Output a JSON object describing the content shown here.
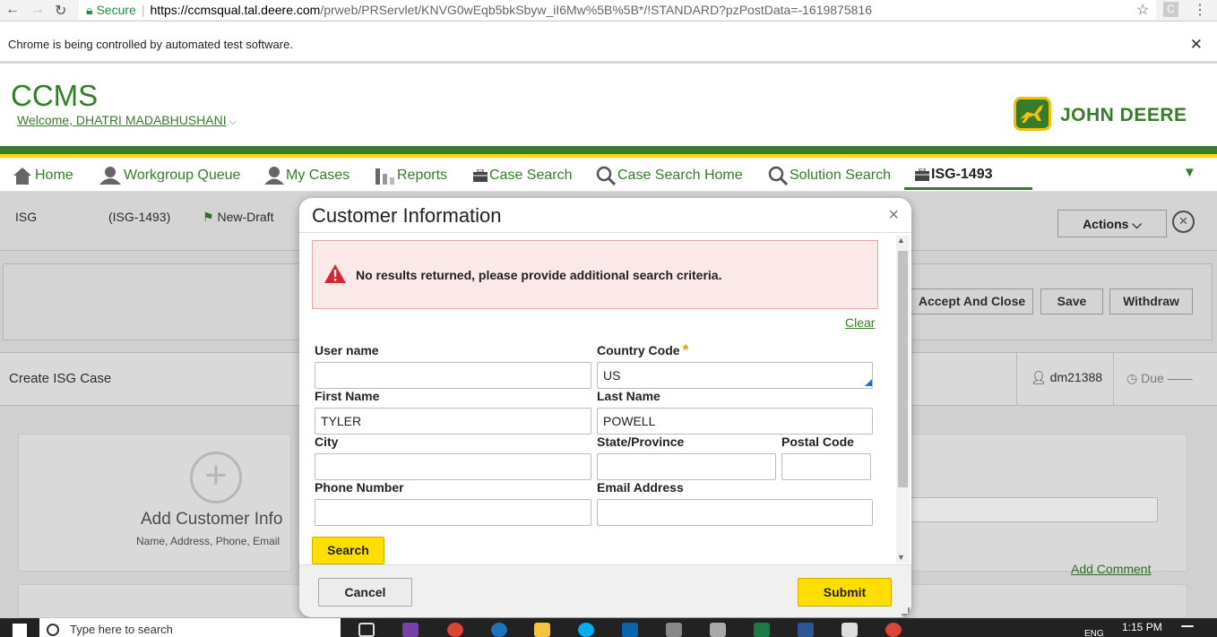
{
  "browser": {
    "secure_label": "Secure",
    "url_domain": "https://ccmsqual.tal.deere.com",
    "url_path": "/prweb/PRServlet/KNVG0wEqb5bkSbyw_iI6Mw%5B%5B*/!STANDARD?pzPostData=-1619875816",
    "profile_label": "C",
    "infobar_text": "Chrome is being controlled by automated test software.",
    "infobar_close": "✕"
  },
  "header": {
    "app_title": "CCMS",
    "welcome_prefix": "Welcome, ",
    "user_name": "DHATRI MADABHUSHANI",
    "logo_text": "JOHN DEERE"
  },
  "nav": {
    "items": [
      {
        "label": "Home",
        "icon": "home-icon"
      },
      {
        "label": "Workgroup Queue",
        "icon": "users-icon"
      },
      {
        "label": "My Cases",
        "icon": "user-icon"
      },
      {
        "label": "Reports",
        "icon": "bar-chart-icon"
      },
      {
        "label": "Case Search",
        "icon": "briefcase-icon"
      },
      {
        "label": "Case Search Home",
        "icon": "search-icon"
      },
      {
        "label": "Solution Search",
        "icon": "search-icon"
      },
      {
        "label": "ISG-1493",
        "icon": "briefcase-icon"
      }
    ],
    "more": "▼"
  },
  "case": {
    "type": "ISG",
    "id": "(ISG-1493)",
    "status": "New-Draft",
    "actions_label": "Actions",
    "buttons": [
      "Accept And Close",
      "Save",
      "Withdraw"
    ],
    "create_title": "Create ISG Case",
    "owner": "dm21388",
    "due_label": "Due",
    "due_value": "——",
    "add_customer_title": "Add Customer Info",
    "add_customer_sub": "Name, Address, Phone, Email",
    "add_comment": "Add Comment"
  },
  "modal": {
    "title": "Customer Information",
    "close": "×",
    "error_message": "No results returned, please provide additional search criteria.",
    "clear_label": "Clear",
    "required_mark": "*",
    "fields": {
      "username": {
        "label": "User name",
        "value": ""
      },
      "country_code": {
        "label": "Country Code",
        "value": "US"
      },
      "first_name": {
        "label": "First Name",
        "value": "TYLER"
      },
      "last_name": {
        "label": "Last Name",
        "value": "POWELL"
      },
      "city": {
        "label": "City",
        "value": ""
      },
      "state": {
        "label": "State/Province",
        "value": ""
      },
      "postal": {
        "label": "Postal Code",
        "value": ""
      },
      "phone": {
        "label": "Phone Number",
        "value": ""
      },
      "email": {
        "label": "Email Address",
        "value": ""
      }
    },
    "search_label": "Search",
    "cancel_label": "Cancel",
    "submit_label": "Submit"
  },
  "taskbar": {
    "search_placeholder": "Type here to search",
    "lang": "ENG",
    "time": "1:15 PM"
  },
  "colors": {
    "brand_green": "#367c2b",
    "brand_yellow": "#ffde00",
    "error_bg": "#fbe8e8",
    "error_icon": "#d9232e"
  }
}
